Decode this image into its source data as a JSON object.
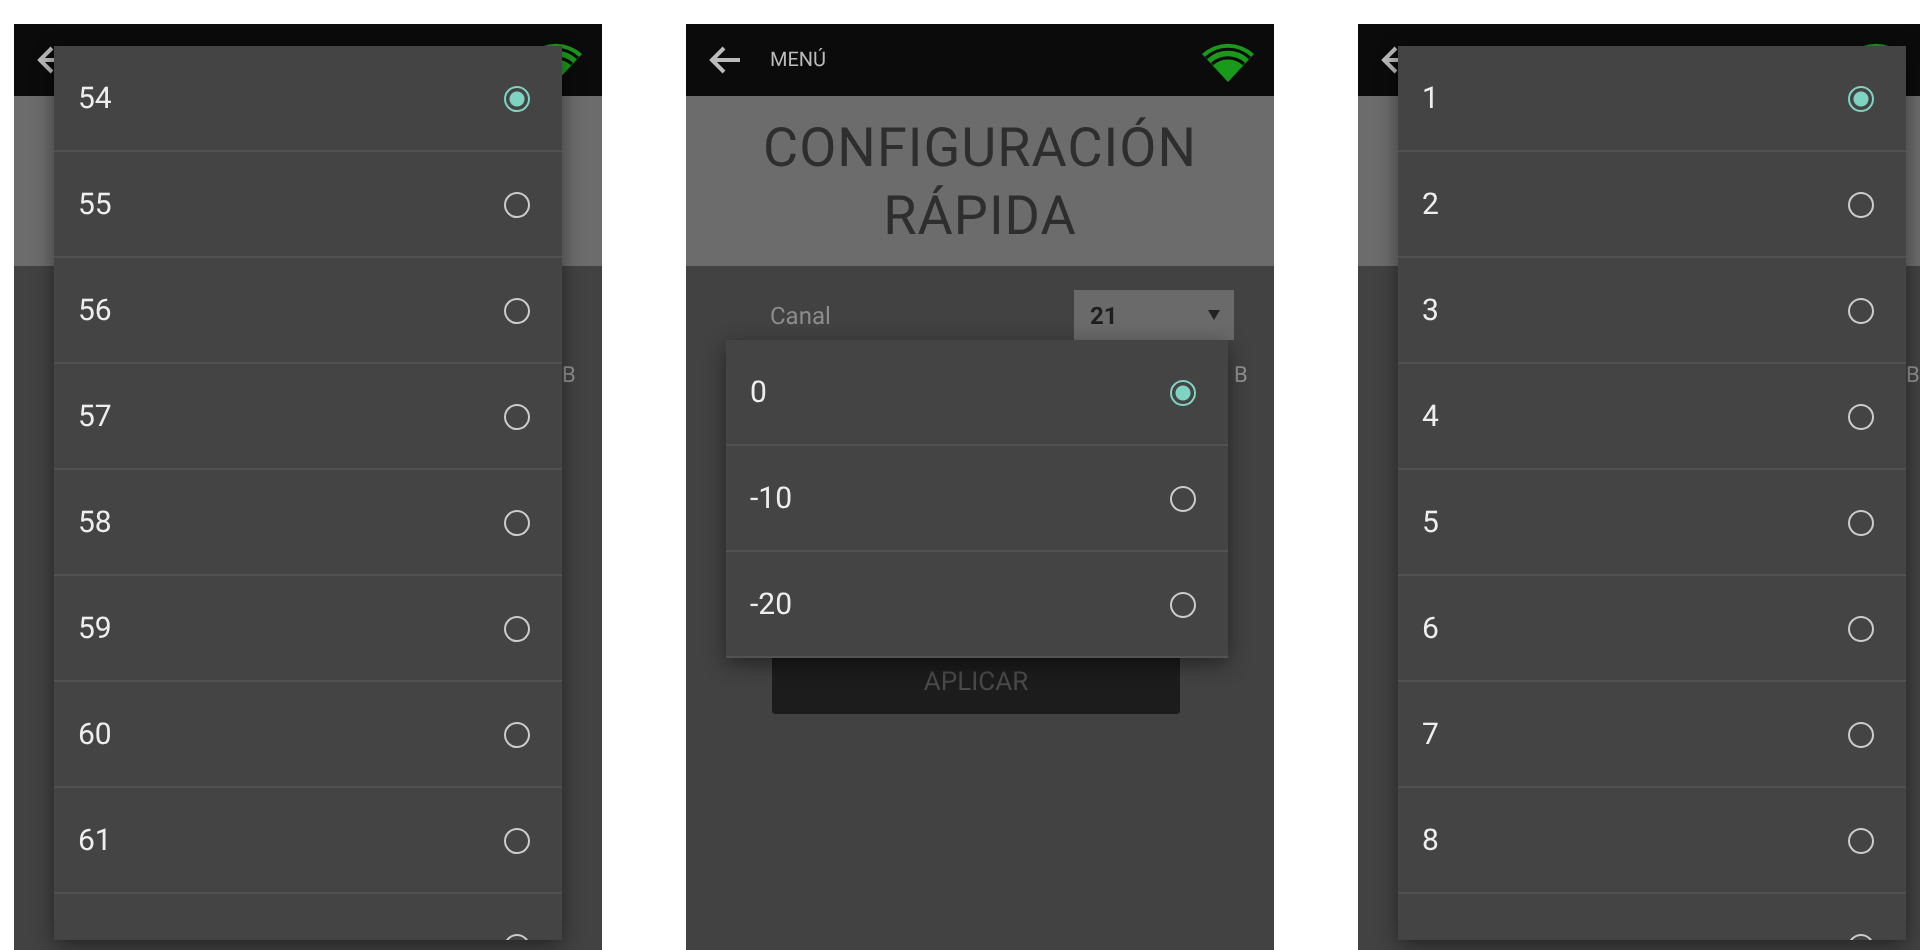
{
  "screens": [
    {
      "unit_fragment": "B",
      "dialog": {
        "kind": "full",
        "options": [
          {
            "label": "54",
            "selected": true
          },
          {
            "label": "55",
            "selected": false
          },
          {
            "label": "56",
            "selected": false
          },
          {
            "label": "57",
            "selected": false
          },
          {
            "label": "58",
            "selected": false
          },
          {
            "label": "59",
            "selected": false
          },
          {
            "label": "60",
            "selected": false
          },
          {
            "label": "61",
            "selected": false
          },
          {
            "selected": false
          }
        ]
      }
    },
    {
      "menu_label": "MENÚ",
      "title": "CONFIGURACIÓN RÁPIDA",
      "fields": [
        {
          "label": "Canal",
          "value": "21"
        }
      ],
      "apply_button": "APLICAR",
      "unit_fragment": "B",
      "dialog": {
        "kind": "anchored",
        "options": [
          {
            "label": "0",
            "selected": true
          },
          {
            "label": "-10",
            "selected": false
          },
          {
            "label": "-20",
            "selected": false
          }
        ]
      }
    },
    {
      "unit_fragment": "B",
      "dialog": {
        "kind": "full",
        "options": [
          {
            "label": "1",
            "selected": true
          },
          {
            "label": "2",
            "selected": false
          },
          {
            "label": "3",
            "selected": false
          },
          {
            "label": "4",
            "selected": false
          },
          {
            "label": "5",
            "selected": false
          },
          {
            "label": "6",
            "selected": false
          },
          {
            "label": "7",
            "selected": false
          },
          {
            "label": "8",
            "selected": false
          },
          {
            "selected": false
          }
        ]
      }
    }
  ]
}
